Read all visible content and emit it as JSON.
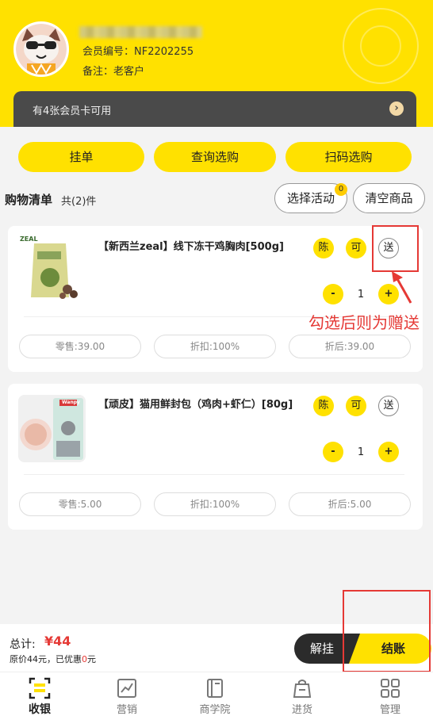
{
  "member": {
    "no_label": "会员编号：",
    "no_value": "NF2202255",
    "remark_label": "备注：",
    "remark_value": "老客户"
  },
  "card_bar": {
    "text": "有4张会员卡可用"
  },
  "actions": {
    "hold": "挂单",
    "query": "查询选购",
    "scan": "扫码选购"
  },
  "cart": {
    "title": "购物清单",
    "count": "共(2)件",
    "select_activity": "选择活动",
    "activity_badge": "0",
    "clear": "清空商品"
  },
  "items": [
    {
      "thumb_brand": "ZEAL",
      "title": "【新西兰zeal】线下冻干鸡胸肉[500g]",
      "tag_chen": "陈",
      "tag_ke": "可",
      "tag_song": "送",
      "minus": "-",
      "qty": "1",
      "plus": "+",
      "retail": "零售:39.00",
      "discount": "折扣:100%",
      "after": "折后:39.00"
    },
    {
      "thumb_brand": "Wanpy",
      "title": "【顽皮】猫用鲜封包（鸡肉+虾仁）[80g]",
      "tag_chen": "陈",
      "tag_ke": "可",
      "tag_song": "送",
      "minus": "-",
      "qty": "1",
      "plus": "+",
      "retail": "零售:5.00",
      "discount": "折扣:100%",
      "after": "折后:5.00"
    }
  ],
  "annotation": {
    "note": "勾选后则为赠送"
  },
  "footer": {
    "total_label": "总计:",
    "total_value": "¥44",
    "orig_prefix": "原价44元，已优惠",
    "orig_discount": "0",
    "orig_suffix": "元",
    "hold_button": "解挂",
    "pay_button": "结账"
  },
  "tabs": [
    {
      "label": "收银",
      "icon": "cashier-icon"
    },
    {
      "label": "营销",
      "icon": "chart-icon"
    },
    {
      "label": "商学院",
      "icon": "book-icon"
    },
    {
      "label": "进货",
      "icon": "bag-icon"
    },
    {
      "label": "管理",
      "icon": "grid-icon"
    }
  ],
  "colors": {
    "accent": "#ffe100",
    "alert": "#e53935",
    "dark": "#2b2b2b"
  }
}
